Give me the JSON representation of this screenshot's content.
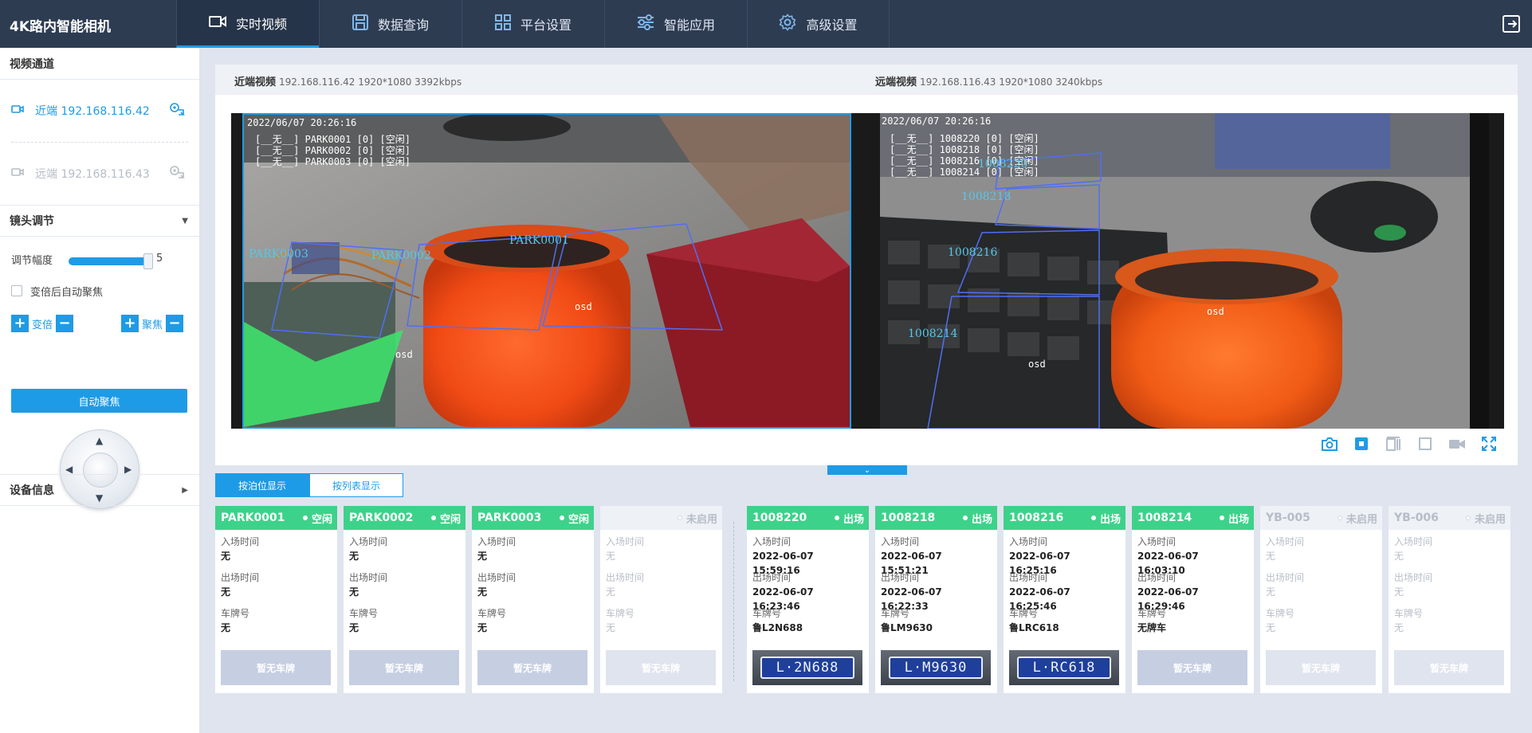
{
  "app": {
    "title": "4K路内智能相机"
  },
  "nav": {
    "tabs": [
      {
        "label": "实时视频",
        "icon": "video-camera-icon",
        "active": true
      },
      {
        "label": "数据查询",
        "icon": "floppy-disk-icon"
      },
      {
        "label": "平台设置",
        "icon": "grid-icon"
      },
      {
        "label": "智能应用",
        "icon": "sliders-icon"
      },
      {
        "label": "高级设置",
        "icon": "gear-icon"
      }
    ]
  },
  "sidebar": {
    "channels_title": "视频通道",
    "channels": [
      {
        "label": "近端 192.168.116.42",
        "active": true
      },
      {
        "label": "远端 192.168.116.43",
        "active": false
      }
    ],
    "lens_title": "镜头调节",
    "adjust_label": "调节幅度",
    "adjust_value": "5",
    "adjust_level": 0.95,
    "auto_focus_checkbox": "变倍后自动聚焦",
    "zoom_label": "变倍",
    "focus_label": "聚焦",
    "plus": "+",
    "minus": "−",
    "auto_focus_button": "自动聚焦",
    "device_info_title": "设备信息"
  },
  "video": {
    "near_label": "近端视频",
    "near_info": "192.168.116.42 1920*1080 3392kbps",
    "far_label": "远端视频",
    "far_info": "192.168.116.43 1920*1080 3240kbps",
    "near_osd": {
      "timestamp": "2022/06/07 20:26:16",
      "lines": [
        "[__无__] PARK0001 [0] [空闲]",
        "[__无__] PARK0002 [0] [空闲]",
        "[__无__] PARK0003 [0] [空闲]"
      ],
      "zones": [
        "PARK0003",
        "PARK0002",
        "PARK0001"
      ],
      "osd": "osd"
    },
    "far_osd": {
      "timestamp": "2022/06/07 20:26:16",
      "lines": [
        "[__无__] 1008220 [0] [空闲]",
        "[__无__] 1008218 [0] [空闲]",
        "[__无__] 1008216 [0] [空闲]",
        "[__无__] 1008214 [0] [空闲]"
      ],
      "zones": [
        "1008220",
        "1008218",
        "1008216",
        "1008214"
      ],
      "osd": "osd"
    }
  },
  "view_tabs": {
    "by_spot": "按泊位显示",
    "by_list": "按列表显示"
  },
  "card_labels": {
    "entry": "入场时间",
    "exit": "出场时间",
    "plate": "车牌号"
  },
  "colors": {
    "accent": "#1e9be6",
    "occupied": "#3dd28a",
    "topbar": "#2e3c52"
  },
  "near_cards": [
    {
      "name": "PARK0001",
      "status": "空闲",
      "entry": "无",
      "exit": "无",
      "plate": "无",
      "button": "暂无车牌"
    },
    {
      "name": "PARK0002",
      "status": "空闲",
      "entry": "无",
      "exit": "无",
      "plate": "无",
      "button": "暂无车牌"
    },
    {
      "name": "PARK0003",
      "status": "空闲",
      "entry": "无",
      "exit": "无",
      "plate": "无",
      "button": "暂无车牌"
    },
    {
      "name": "",
      "status": "未启用",
      "entry": "无",
      "exit": "无",
      "plate": "无",
      "button": "暂无车牌"
    }
  ],
  "far_cards": [
    {
      "name": "1008220",
      "status": "出场",
      "entry": "2022-06-07 15:59:16",
      "exit": "2022-06-07 16:23:46",
      "plate": "鲁L2N688",
      "plate_image": "L·2N688"
    },
    {
      "name": "1008218",
      "status": "出场",
      "entry": "2022-06-07 15:51:21",
      "exit": "2022-06-07 16:22:33",
      "plate": "鲁LM9630",
      "plate_image": "L·M9630"
    },
    {
      "name": "1008216",
      "status": "出场",
      "entry": "2022-06-07 16:25:16",
      "exit": "2022-06-07 16:25:46",
      "plate": "鲁LRC618",
      "plate_image": "L·RC618"
    },
    {
      "name": "1008214",
      "status": "出场",
      "entry": "2022-06-07 16:03:10",
      "exit": "2022-06-07 16:29:46",
      "plate": "无牌车",
      "button": "暂无车牌"
    },
    {
      "name": "YB-005",
      "status": "未启用",
      "entry": "无",
      "exit": "无",
      "plate": "无",
      "button": "暂无车牌"
    },
    {
      "name": "YB-006",
      "status": "未启用",
      "entry": "无",
      "exit": "无",
      "plate": "无",
      "button": "暂无车牌"
    }
  ]
}
